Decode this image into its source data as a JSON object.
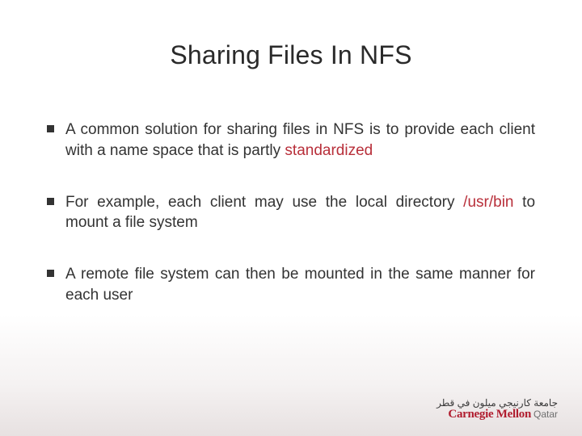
{
  "title": "Sharing Files In NFS",
  "bullets": {
    "b0": {
      "pre": "A common solution for sharing files in NFS is to provide each client with a name space that is partly ",
      "em": "standardized",
      "post": ""
    },
    "b1": {
      "pre": "For example, each client may use the local directory ",
      "em": "/usr/bin",
      "post": " to mount a file system"
    },
    "b2": {
      "pre": "A remote file system can then be mounted in the same manner for each user",
      "em": "",
      "post": ""
    }
  },
  "logo": {
    "arabic": "جامعة كارنيجي ميلون في قطر",
    "line1": "Carnegie Mellon",
    "qatar": "Qatar"
  }
}
